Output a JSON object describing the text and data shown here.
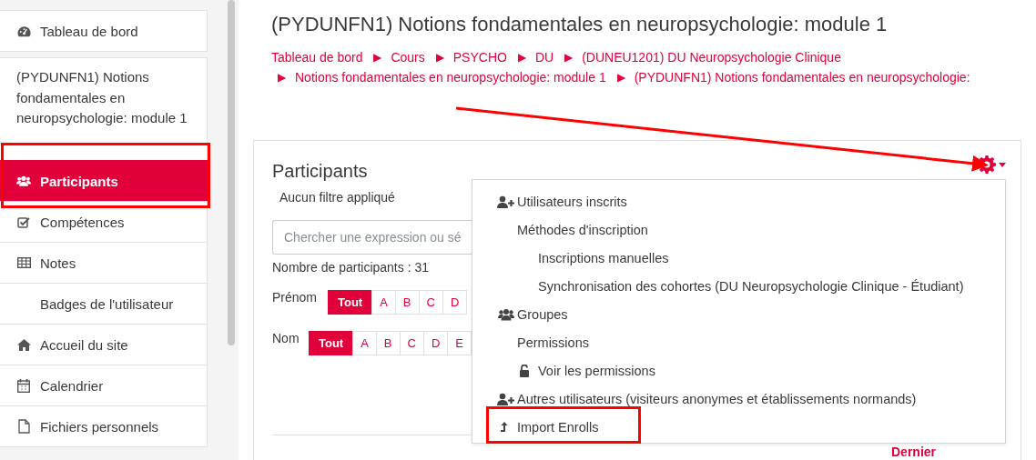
{
  "sidebar": {
    "items": [
      {
        "label": "Tableau de bord",
        "selected": false
      },
      {
        "label": "(PYDUNFN1) Notions fondamentales en neuropsychologie: module 1",
        "selected": false
      },
      {
        "label": "Participants",
        "selected": true
      },
      {
        "label": "Compétences",
        "selected": false
      },
      {
        "label": "Notes",
        "selected": false
      },
      {
        "label": "Badges de l'utilisateur",
        "selected": false
      },
      {
        "label": "Accueil du site",
        "selected": false
      },
      {
        "label": "Calendrier",
        "selected": false
      },
      {
        "label": "Fichiers personnels",
        "selected": false
      }
    ]
  },
  "page": {
    "title": "(PYDUNFN1) Notions fondamentales en neuropsychologie: module 1",
    "breadcrumb": [
      {
        "label": "Tableau de bord"
      },
      {
        "prefix": "▶",
        "label": "Cours"
      },
      {
        "prefix": "▶",
        "label": "PSYCHO"
      },
      {
        "prefix": "▶",
        "label": "DU"
      },
      {
        "prefix": "▶",
        "label": "(DUNEU1201) DU Neuropsychologie Clinique"
      },
      {
        "prefix": "▶",
        "label": "Notions fondamentales en neuropsychologie: module 1"
      },
      {
        "prefix": "▶",
        "label": "(PYDUNFN1) Notions fondamentales en neuropsychologie:"
      }
    ]
  },
  "card": {
    "title": "Participants",
    "filter_status": "Aucun filtre appliqué",
    "search": {
      "placeholder": "Chercher une expression ou sé"
    },
    "count": "Nombre de participants : 31",
    "initials": [
      {
        "label": "Prénom",
        "letters": [
          {
            "text": "Tout",
            "selected": true
          },
          {
            "text": "A",
            "selected": false
          },
          {
            "text": "B",
            "selected": false
          },
          {
            "text": "C",
            "selected": false
          },
          {
            "text": "D",
            "selected": false
          }
        ]
      },
      {
        "label": "Nom",
        "letters": [
          {
            "text": "Tout",
            "selected": true
          },
          {
            "text": "A",
            "selected": false
          },
          {
            "text": "B",
            "selected": false
          },
          {
            "text": "C",
            "selected": false
          },
          {
            "text": "D",
            "selected": false
          },
          {
            "text": "E",
            "selected": false
          }
        ]
      }
    ],
    "pagination": {
      "last": "Dernier"
    }
  },
  "actions_menu": {
    "expanded": true,
    "items": [
      {
        "label": "Utilisateurs inscrits"
      },
      {
        "label": "Méthodes d'inscription",
        "children": [
          {
            "label": "Inscriptions manuelles"
          },
          {
            "label": "Synchronisation des cohortes (DU Neuropsychologie Clinique - Étudiant)"
          }
        ]
      },
      {
        "label": "Groupes"
      },
      {
        "label": "Permissions",
        "children": [
          {
            "label": "Voir les permissions"
          }
        ]
      },
      {
        "label": "Autres utilisateurs (visiteurs anonymes et établissements normands)"
      },
      {
        "label": "Import Enrolls"
      }
    ]
  }
}
